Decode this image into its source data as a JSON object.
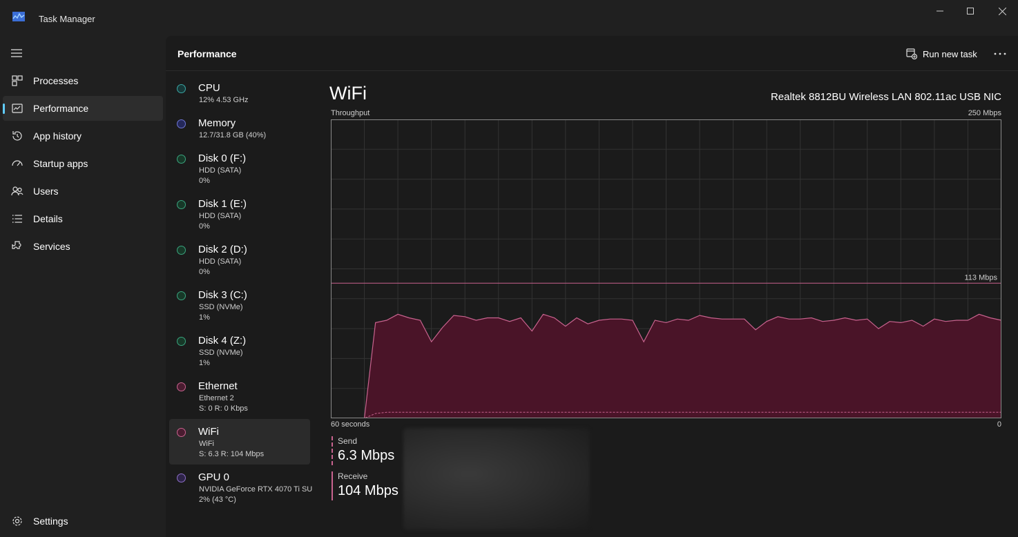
{
  "window": {
    "title": "Task Manager",
    "controls": {
      "minimize_icon": "minimize-icon",
      "maximize_icon": "maximize-icon",
      "close_icon": "close-icon"
    }
  },
  "nav": {
    "items": [
      {
        "label": "Processes",
        "icon": "processes-icon"
      },
      {
        "label": "Performance",
        "icon": "performance-icon",
        "active": true
      },
      {
        "label": "App history",
        "icon": "history-icon"
      },
      {
        "label": "Startup apps",
        "icon": "startup-icon"
      },
      {
        "label": "Users",
        "icon": "users-icon"
      },
      {
        "label": "Details",
        "icon": "details-icon"
      },
      {
        "label": "Services",
        "icon": "services-icon"
      }
    ],
    "settings": {
      "label": "Settings",
      "icon": "gear-icon"
    }
  },
  "header": {
    "title": "Performance",
    "run_new_task": "Run new task",
    "more_icon": "more-icon"
  },
  "devices": [
    {
      "name": "CPU",
      "sub1": "12%  4.53 GHz",
      "color": "#3aa5a3"
    },
    {
      "name": "Memory",
      "sub1": "12.7/31.8 GB (40%)",
      "color": "#6f77d6"
    },
    {
      "name": "Disk 0 (F:)",
      "sub1": "HDD (SATA)",
      "sub2": "0%",
      "color": "#3aa57f"
    },
    {
      "name": "Disk 1 (E:)",
      "sub1": "HDD (SATA)",
      "sub2": "0%",
      "color": "#3aa57f"
    },
    {
      "name": "Disk 2 (D:)",
      "sub1": "HDD (SATA)",
      "sub2": "0%",
      "color": "#3aa57f"
    },
    {
      "name": "Disk 3 (C:)",
      "sub1": "SSD (NVMe)",
      "sub2": "1%",
      "color": "#3aa57f"
    },
    {
      "name": "Disk 4 (Z:)",
      "sub1": "SSD (NVMe)",
      "sub2": "1%",
      "color": "#3aa57f"
    },
    {
      "name": "Ethernet",
      "sub1": "Ethernet 2",
      "sub2": "S: 0  R: 0 Kbps",
      "color": "#c9638f"
    },
    {
      "name": "WiFi",
      "sub1": "WiFi",
      "sub2": "S: 6.3  R: 104 Mbps",
      "color": "#c9638f",
      "active": true
    },
    {
      "name": "GPU 0",
      "sub1": "NVIDIA GeForce RTX 4070 Ti SU",
      "sub2": "2%  (43 °C)",
      "color": "#8e6fc9"
    }
  ],
  "detail": {
    "title": "WiFi",
    "adapter": "Realtek 8812BU Wireless LAN 802.11ac USB NIC",
    "throughput_label": "Throughput",
    "y_max_label": "250 Mbps",
    "x_left_label": "60 seconds",
    "x_right_label": "0",
    "marker_label": "113 Mbps",
    "send": {
      "label": "Send",
      "value": "6.3 Mbps"
    },
    "receive": {
      "label": "Receive",
      "value": "104 Mbps"
    }
  },
  "colors": {
    "accent": "#60cdff",
    "network": "#c9638f",
    "graph_fill": "#4a1428",
    "grid": "#333333"
  },
  "chart_data": {
    "type": "area",
    "ylim": [
      0,
      250
    ],
    "xlim": [
      60,
      0
    ],
    "grid": true,
    "marker_line": 113,
    "series": [
      {
        "name": "Receive",
        "style": "solid",
        "x": [
          60,
          57,
          56,
          55,
          54,
          53,
          52,
          51,
          50,
          49,
          48,
          47,
          46,
          45,
          44,
          43,
          42,
          41,
          40,
          39,
          38,
          37,
          36,
          35,
          34,
          33,
          32,
          31,
          30,
          29,
          28,
          27,
          26,
          25,
          24,
          23,
          22,
          21,
          20,
          19,
          18,
          17,
          16,
          15,
          14,
          13,
          12,
          11,
          10,
          9,
          8,
          7,
          6,
          5,
          4,
          3,
          2,
          1,
          0
        ],
        "values": [
          0,
          0,
          80,
          82,
          87,
          84,
          82,
          64,
          76,
          86,
          85,
          82,
          84,
          84,
          81,
          84,
          73,
          87,
          84,
          77,
          84,
          79,
          82,
          83,
          83,
          82,
          64,
          82,
          80,
          83,
          82,
          86,
          84,
          83,
          83,
          83,
          74,
          81,
          85,
          83,
          83,
          84,
          81,
          82,
          84,
          82,
          83,
          75,
          81,
          80,
          82,
          77,
          83,
          81,
          82,
          82,
          87,
          84,
          82
        ]
      },
      {
        "name": "Send",
        "style": "dashed",
        "x": [
          60,
          57,
          56,
          55,
          0
        ],
        "values": [
          0,
          0,
          4,
          5,
          5
        ]
      }
    ]
  }
}
